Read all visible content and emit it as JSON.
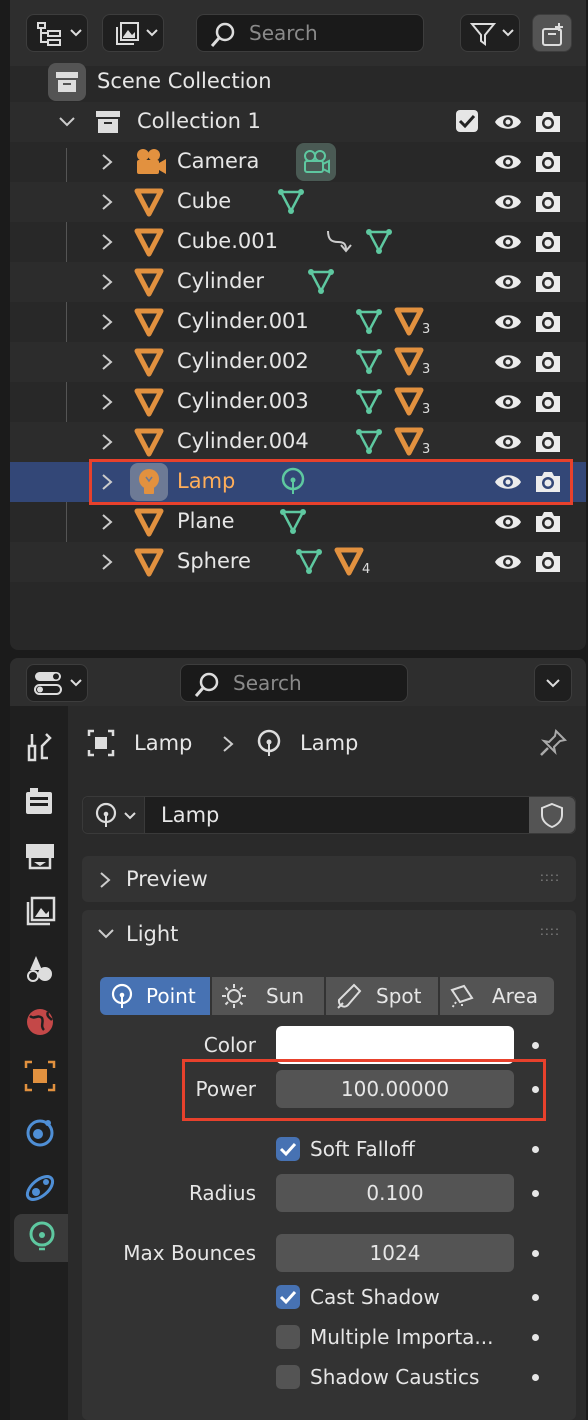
{
  "outliner": {
    "search_placeholder": "Search",
    "scene_collection": "Scene Collection",
    "collection": "Collection 1",
    "rows": [
      {
        "name": "Camera"
      },
      {
        "name": "Cube"
      },
      {
        "name": "Cube.001"
      },
      {
        "name": "Cylinder"
      },
      {
        "name": "Cylinder.001",
        "count": "3"
      },
      {
        "name": "Cylinder.002",
        "count": "3"
      },
      {
        "name": "Cylinder.003",
        "count": "3"
      },
      {
        "name": "Cylinder.004",
        "count": "3"
      },
      {
        "name": "Lamp"
      },
      {
        "name": "Plane"
      },
      {
        "name": "Sphere",
        "count": "4"
      }
    ]
  },
  "properties": {
    "search_placeholder": "Search",
    "breadcrumb": {
      "object": "Lamp",
      "data": "Lamp"
    },
    "datablock_name": "Lamp",
    "panels": {
      "preview": "Preview",
      "light": "Light"
    },
    "light_types": [
      "Point",
      "Sun",
      "Spot",
      "Area"
    ],
    "selected_light_type": "Point",
    "fields": {
      "color_label": "Color",
      "color_value": "#ffffff",
      "power_label": "Power",
      "power_value": "100.00000",
      "soft_falloff_label": "Soft Falloff",
      "soft_falloff": true,
      "radius_label": "Radius",
      "radius_value": "0.100",
      "max_bounces_label": "Max Bounces",
      "max_bounces_value": "1024",
      "cast_shadow_label": "Cast Shadow",
      "cast_shadow": true,
      "multiple_importance_label": "Multiple Importa...",
      "multiple_importance": false,
      "shadow_caustics_label": "Shadow Caustics",
      "shadow_caustics": false
    }
  },
  "colors": {
    "selection_bg": "#334777",
    "selected_text": "#ffae5a",
    "mesh_orange": "#e2913f",
    "data_green": "#5ec8a0",
    "active_blue": "#4772b3",
    "highlight_red": "#e8412c"
  }
}
